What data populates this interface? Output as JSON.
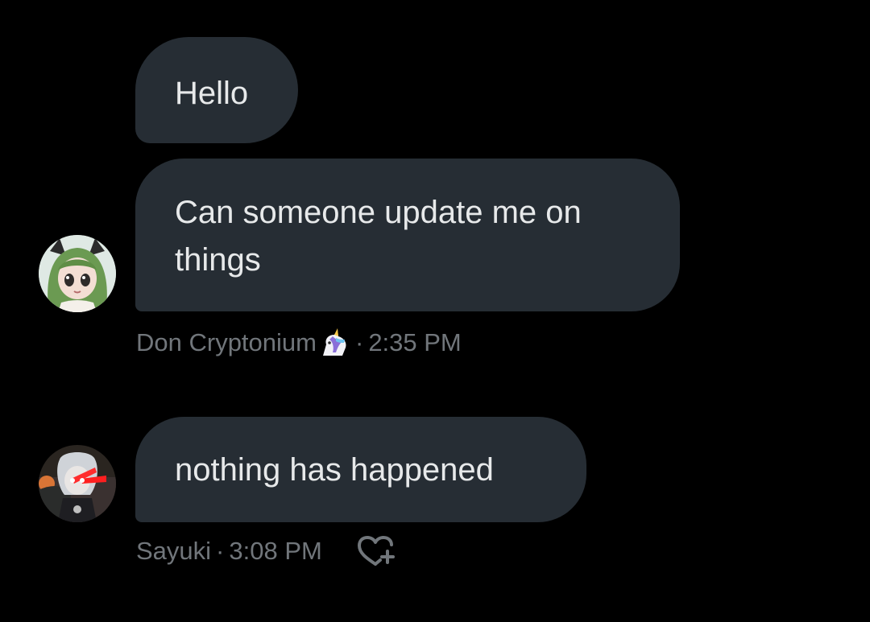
{
  "messages": [
    {
      "id": "m1",
      "text_1": "Hello",
      "text_2": "Can someone update me on things",
      "sender": "Don Cryptonium",
      "sender_badge": "unicorn",
      "separator": "·",
      "time": "2:35 PM"
    },
    {
      "id": "m2",
      "text": "nothing has happened",
      "sender": "Sayuki",
      "separator": "·",
      "time": "3:08 PM"
    }
  ],
  "colors": {
    "background": "#000000",
    "bubble": "#262d34",
    "text": "#e7e9ea",
    "meta": "#71767b"
  },
  "icons": {
    "badge": "unicorn-icon",
    "reaction": "heart-plus-icon"
  }
}
